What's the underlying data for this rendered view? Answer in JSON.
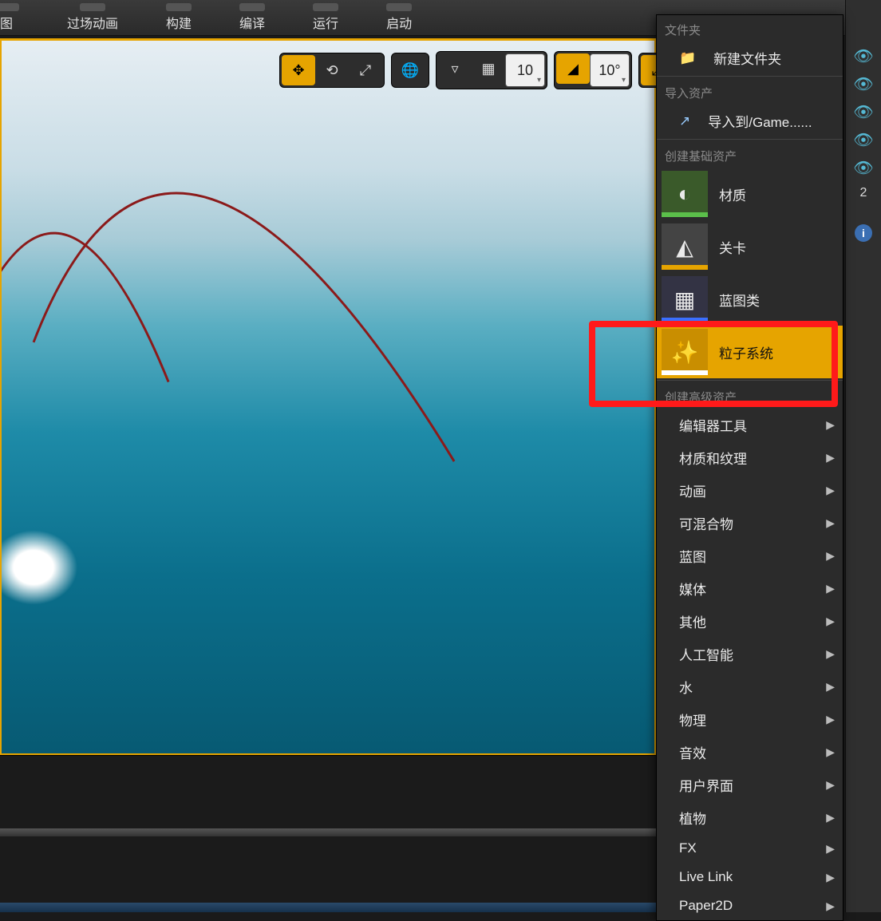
{
  "toolbar": {
    "btn_graph": "图",
    "btn_matinee": "过场动画",
    "btn_build": "构建",
    "btn_compile": "编译",
    "btn_run": "运行",
    "btn_launch": "启动"
  },
  "viewport": {
    "grid_value": "10",
    "angle_value": "10°"
  },
  "context_menu": {
    "section_folder": "文件夹",
    "new_folder": "新建文件夹",
    "section_import": "导入资产",
    "import_to": "导入到/Game......",
    "section_basic": "创建基础资产",
    "material": "材质",
    "level": "关卡",
    "blueprint": "蓝图类",
    "particle": "粒子系统",
    "section_adv": "创建高级资产",
    "adv_items": [
      "编辑器工具",
      "材质和纹理",
      "动画",
      "可混合物",
      "蓝图",
      "媒体",
      "其他",
      "人工智能",
      "水",
      "物理",
      "音效",
      "用户界面",
      "植物",
      "FX",
      "Live Link",
      "Paper2D"
    ]
  },
  "right_strip": {
    "counter": "2"
  },
  "colors": {
    "material_underline": "#5bbf4a",
    "level_underline": "#e6a400",
    "blueprint_underline": "#3b6fff",
    "particle_underline": "#ffffff",
    "highlight_bg": "#e6a400",
    "annotation": "#ff1a1a"
  }
}
